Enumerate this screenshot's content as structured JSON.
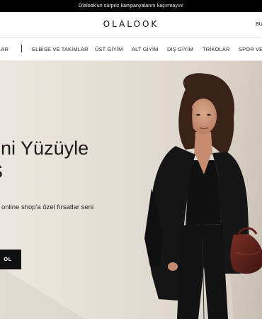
{
  "announcement": "Olalook'un sürpriz kampanyalarını kaçırmayın!",
  "header": {
    "logo": "OLALOOK",
    "right_link": "BU"
  },
  "nav": {
    "items": [
      "LAR",
      "ELBİSE VE TAKIMLAR",
      "ÜST GİYİM",
      "ALT GİYİM",
      "DIŞ GİYİM",
      "TRİKOLAR",
      "SPOR VE"
    ]
  },
  "hero": {
    "title_line1": "eni Yüzüyle",
    "title_line2": "Ş",
    "subtitle": "online shop'a özel fırsatlar seni",
    "button_label": "OL"
  }
}
